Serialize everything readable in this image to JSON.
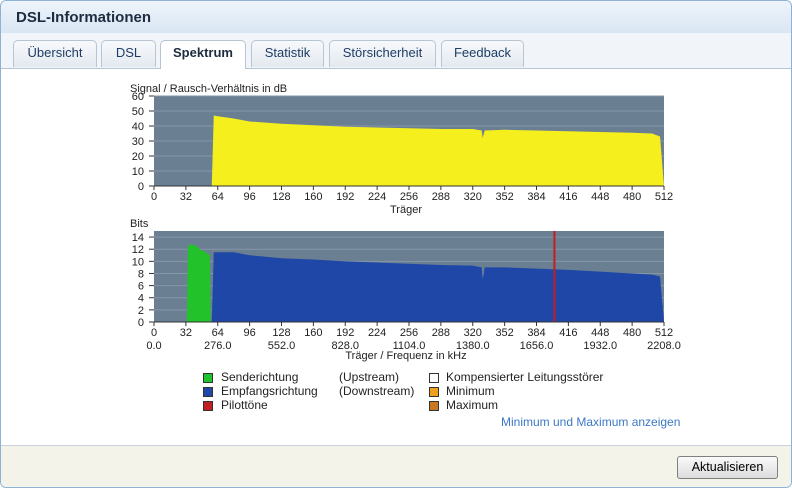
{
  "panel": {
    "title": "DSL-Informationen"
  },
  "tabs": [
    {
      "label": "Übersicht",
      "active": false
    },
    {
      "label": "DSL",
      "active": false
    },
    {
      "label": "Spektrum",
      "active": true
    },
    {
      "label": "Statistik",
      "active": false
    },
    {
      "label": "Störsicherheit",
      "active": false
    },
    {
      "label": "Feedback",
      "active": false
    }
  ],
  "chart_data": [
    {
      "type": "area",
      "ylabel": "Signal / Rausch-Verhältnis in dB",
      "xlabel": "Träger",
      "xlim": [
        0,
        512
      ],
      "ylim": [
        0,
        60
      ],
      "xticks": [
        "0",
        "32",
        "64",
        "96",
        "128",
        "160",
        "192",
        "224",
        "256",
        "288",
        "320",
        "352",
        "384",
        "416",
        "448",
        "480",
        "512"
      ],
      "yticks": [
        "0",
        "10",
        "20",
        "30",
        "40",
        "50",
        "60"
      ],
      "background": "#6b7f93",
      "fill": "#f5ef1e",
      "series": [
        {
          "x": [
            58,
            60,
            64,
            80,
            96,
            128,
            160,
            192,
            224,
            256,
            288,
            320,
            329,
            330,
            332,
            352,
            384,
            416,
            448,
            480,
            500,
            508,
            512
          ],
          "values": [
            0,
            47,
            46.5,
            45,
            43,
            41.5,
            40.5,
            39.5,
            39,
            38.5,
            38,
            38,
            37,
            32,
            37,
            37.5,
            37,
            36.5,
            36,
            35.5,
            35,
            33,
            0
          ]
        }
      ]
    },
    {
      "type": "area",
      "ylabel": "Bits",
      "xlabel": "Träger / Frequenz in kHz",
      "xlim": [
        0,
        512
      ],
      "ylim": [
        0,
        15
      ],
      "xticks": [
        "0",
        "32",
        "64",
        "96",
        "128",
        "160",
        "192",
        "224",
        "256",
        "288",
        "320",
        "352",
        "384",
        "416",
        "448",
        "480",
        "512"
      ],
      "yticks": [
        "0",
        "2",
        "4",
        "6",
        "8",
        "10",
        "12",
        "14"
      ],
      "freq_ticks": [
        "0.0",
        "276.0",
        "552.0",
        "828.0",
        "1104.0",
        "1380.0",
        "1656.0",
        "1932.0",
        "2208.0"
      ],
      "background": "#6b7f93",
      "series": [
        {
          "name": "Senderichtung (Upstream)",
          "color": "#22c22a",
          "x": [
            33,
            34,
            36,
            42,
            46,
            52,
            56,
            57
          ],
          "values": [
            0,
            12.5,
            12.8,
            12.6,
            12,
            11.5,
            11,
            0
          ]
        },
        {
          "name": "Empfangsrichtung (Downstream)",
          "color": "#1f47a8",
          "x": [
            58,
            60,
            64,
            80,
            96,
            128,
            160,
            192,
            224,
            256,
            288,
            320,
            329,
            330,
            332,
            352,
            384,
            416,
            448,
            480,
            500,
            508,
            512
          ],
          "values": [
            0,
            11.5,
            11.5,
            11.5,
            11,
            10.5,
            10.3,
            10,
            9.8,
            9.6,
            9.4,
            9.3,
            9,
            7,
            9,
            9,
            8.8,
            8.6,
            8.3,
            8,
            7.8,
            7.5,
            0
          ]
        },
        {
          "name": "Pilottöne",
          "color": "#c0201e",
          "x": [
            402
          ],
          "values": [
            15
          ]
        }
      ]
    }
  ],
  "legend": {
    "send": "Senderichtung",
    "send_dir": "(Upstream)",
    "recv": "Empfangsrichtung",
    "recv_dir": "(Downstream)",
    "pilot": "Pilottöne",
    "comp": "Kompensierter Leitungsstörer",
    "min": "Minimum",
    "max": "Maximum",
    "colors": {
      "send": "#22c22a",
      "recv": "#1f47a8",
      "pilot": "#c0201e",
      "comp": "#ffffff",
      "min": "#f0a020",
      "max": "#c87820"
    }
  },
  "link_minmax": "Minimum und Maximum anzeigen",
  "refresh_button": "Aktualisieren"
}
